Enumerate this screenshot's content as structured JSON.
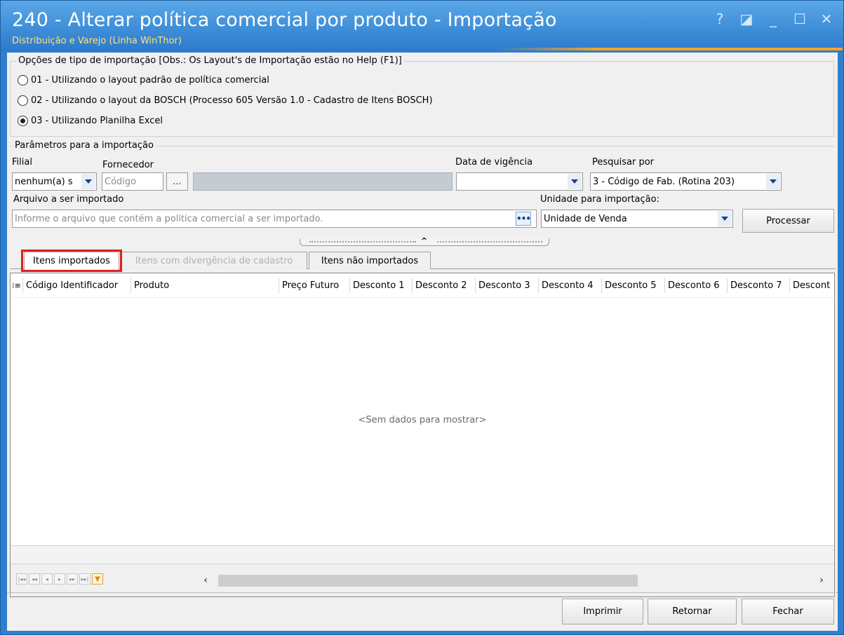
{
  "window": {
    "title": "240 - Alterar política comercial por produto - Importação",
    "subtitle": "Distribuição e Varejo (Linha WinThor)",
    "controls": {
      "help": "?",
      "restore": "◪",
      "minimize": "_",
      "maximize": "☐",
      "close": "✕"
    }
  },
  "import_options": {
    "legend": "Opções de tipo de importação  [Obs.: Os Layout's de Importação estão no Help (F1)]",
    "options": [
      {
        "label": "01 - Utilizando o layout padrão de política comercial",
        "checked": false
      },
      {
        "label": "02 - Utilizando o layout da BOSCH (Processo 605 Versão 1.0 - Cadastro de Itens BOSCH)",
        "checked": false
      },
      {
        "label": "03 - Utilizando Planilha Excel",
        "checked": true
      }
    ]
  },
  "params": {
    "legend": "Parâmetros para a importação",
    "filial_label": "Filial",
    "filial_value": "nenhum(a) s",
    "fornecedor_label": "Fornecedor",
    "fornecedor_placeholder": "Código",
    "fornecedor_btn": "...",
    "data_vigencia_label": "Data de vigência",
    "data_vigencia_value": "",
    "pesquisar_label": "Pesquisar por",
    "pesquisar_value": "3 - Código de Fab. (Rotina 203)",
    "arquivo_label": "Arquivo a ser importado",
    "arquivo_placeholder": "Informe o arquivo que contém a politica comercial a ser importado.",
    "arquivo_btn": "•••",
    "unidade_label": "Unidade para importação:",
    "unidade_value": "Unidade de Venda",
    "processar_label": "Processar"
  },
  "tabs": [
    {
      "label": "Itens importados",
      "state": "active"
    },
    {
      "label": "Itens com divergência de cadastro",
      "state": "disabled"
    },
    {
      "label": "Itens não importados",
      "state": "normal"
    }
  ],
  "grid": {
    "columns": [
      "Código Identificador",
      "Produto",
      "Preço Futuro",
      "Desconto 1",
      "Desconto 2",
      "Desconto 3",
      "Desconto 4",
      "Desconto 5",
      "Desconto 6",
      "Desconto 7",
      "Descont"
    ],
    "empty_message": "<Sem dados para mostrar>",
    "nav_icons": [
      "first-icon",
      "prev-page-icon",
      "prev-icon",
      "next-icon",
      "next-page-icon",
      "last-icon",
      "filter-icon"
    ],
    "scroll_left": "‹",
    "scroll_right": "›"
  },
  "footer": {
    "imprimir": "Imprimir",
    "retornar": "Retornar",
    "fechar": "Fechar"
  },
  "colors": {
    "title_bg": "#3f8ed8",
    "subtitle": "#ffe27a",
    "highlight": "#e01e1e"
  }
}
